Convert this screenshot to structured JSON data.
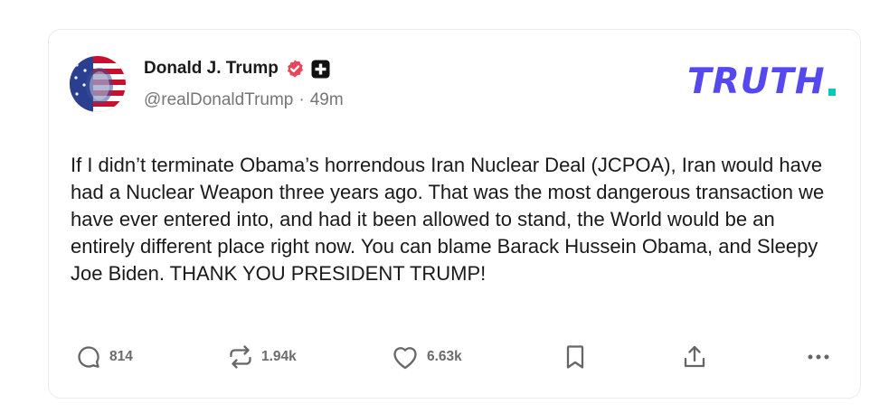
{
  "post": {
    "author": {
      "display_name": "Donald J. Trump",
      "handle": "@realDonaldTrump",
      "separator": "·",
      "time_ago": "49m",
      "verified_color": "#e9465b"
    },
    "brand": {
      "logo_text": "TRUTH",
      "logo_color": "#5448ee",
      "dot_color": "#0bc6bd"
    },
    "text": "If I didn’t terminate Obama’s horrendous Iran Nuclear Deal (JCPOA), Iran would have had a Nuclear Weapon three years ago. That was the most dangerous transaction we have ever entered into, and had it been allowed to stand, the World would be an entirely different place right now. You can blame Barack Hussein Obama, and Sleepy Joe Biden. THANK YOU PRESIDENT TRUMP!",
    "actions": {
      "reply": {
        "icon": "reply-bubble-icon",
        "count": "814"
      },
      "retruth": {
        "icon": "retruth-icon",
        "count": "1.94k"
      },
      "like": {
        "icon": "heart-icon",
        "count": "6.63k"
      },
      "bookmark": {
        "icon": "bookmark-icon"
      },
      "share": {
        "icon": "share-icon"
      },
      "more": {
        "icon": "more-dots-icon"
      }
    }
  }
}
